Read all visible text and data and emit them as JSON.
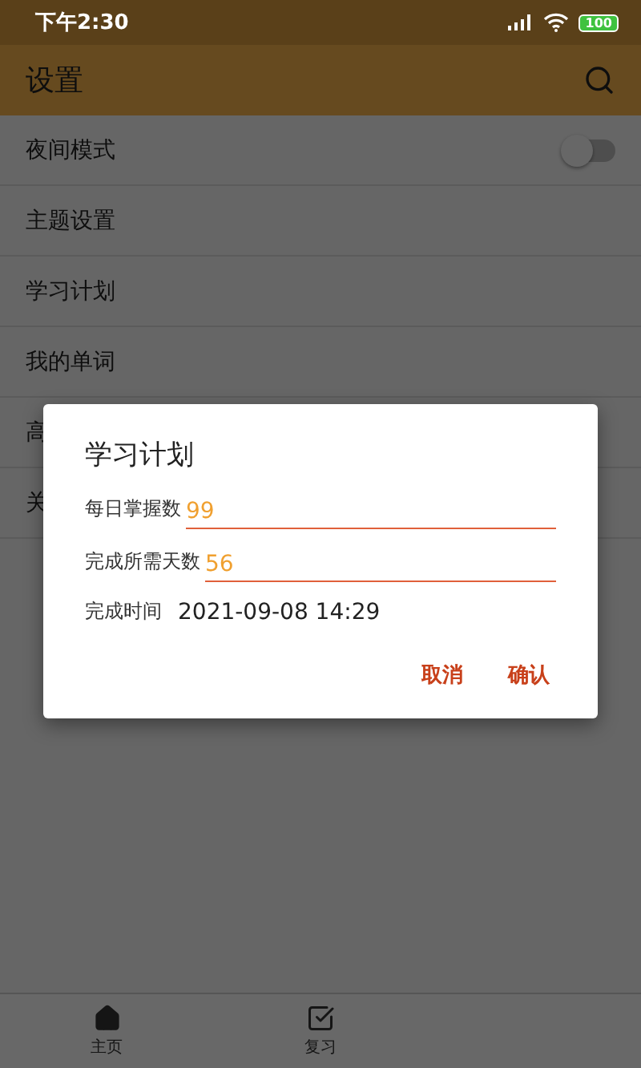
{
  "status_bar": {
    "time": "下午2:30",
    "battery": "100"
  },
  "toolbar": {
    "title": "设置"
  },
  "settings": [
    {
      "label": "夜间模式",
      "kind": "toggle",
      "on": false
    },
    {
      "label": "主题设置",
      "kind": "link"
    },
    {
      "label": "学习计划",
      "kind": "link"
    },
    {
      "label": "我的单词",
      "kind": "link"
    },
    {
      "label": "高",
      "kind": "link"
    },
    {
      "label": "关",
      "kind": "link"
    }
  ],
  "dialog": {
    "title": "学习计划",
    "fields": [
      {
        "label": "每日掌握数",
        "value": "99"
      },
      {
        "label": "完成所需天数",
        "value": "56"
      }
    ],
    "result": {
      "label": "完成时间",
      "value": "2021-09-08 14:29"
    },
    "buttons": [
      "取消",
      "确认"
    ]
  },
  "bottom_nav": [
    {
      "label": "主页",
      "kind": "home"
    },
    {
      "label": "复习",
      "kind": "review"
    }
  ]
}
